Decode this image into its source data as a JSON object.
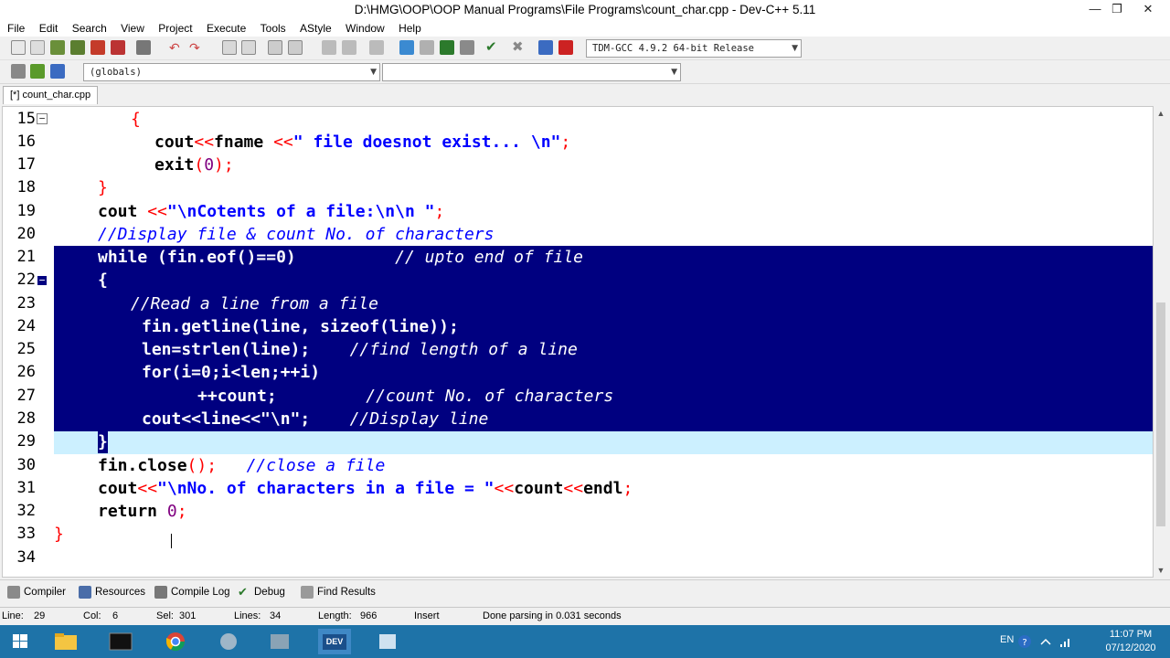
{
  "window": {
    "title": "D:\\HMG\\OOP\\OOP Manual Programs\\File Programs\\count_char.cpp - Dev-C++ 5.11",
    "minimize": "—",
    "maximize": "❐",
    "close": "✕"
  },
  "menu": [
    "File",
    "Edit",
    "Search",
    "View",
    "Project",
    "Execute",
    "Tools",
    "AStyle",
    "Window",
    "Help"
  ],
  "toolbar": {
    "compiler_select": "TDM-GCC 4.9.2 64-bit Release",
    "scope_select": "(globals)",
    "member_select": ""
  },
  "tab": {
    "label": "[*] count_char.cpp"
  },
  "editor": {
    "line_numbers": [
      "15",
      "16",
      "17",
      "18",
      "19",
      "20",
      "21",
      "22",
      "23",
      "24",
      "25",
      "26",
      "27",
      "28",
      "29",
      "30",
      "31",
      "32",
      "33",
      "34"
    ],
    "selected_lines": [
      "21",
      "22",
      "23",
      "24",
      "25",
      "26",
      "27",
      "28"
    ],
    "current_line": "29"
  },
  "bottom_tabs": [
    "Compiler",
    "Resources",
    "Compile Log",
    "Debug",
    "Find Results"
  ],
  "status": {
    "line_label": "Line:",
    "line": "29",
    "col_label": "Col:",
    "col": "6",
    "sel_label": "Sel:",
    "sel": "301",
    "lines_label": "Lines:",
    "lines": "34",
    "length_label": "Length:",
    "length": "966",
    "mode": "Insert",
    "message": "Done parsing in 0.031 seconds"
  },
  "taskbar": {
    "lang": "EN",
    "time": "11:07 PM",
    "date": "07/12/2020",
    "dev_label": "DEV"
  },
  "colors": {
    "selection": "#000080",
    "current_line": "#ccf0ff",
    "string": "#0000ff",
    "comment": "#0000ff",
    "symbol": "#ff0000",
    "number": "#800080",
    "taskbar": "#1e73a8"
  }
}
